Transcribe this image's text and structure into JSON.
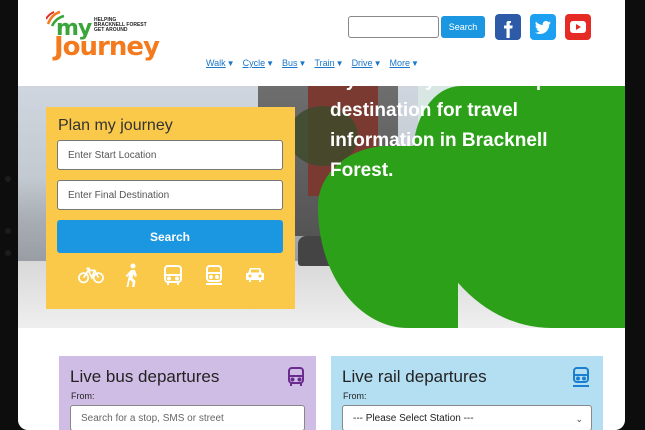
{
  "header": {
    "logo": {
      "word1": "my",
      "word2": "Journey",
      "tagline": [
        "HELPING",
        "BRACKNELL FOREST",
        "GET AROUND"
      ]
    },
    "search": {
      "value": "",
      "placeholder": "",
      "button_label": "Search"
    },
    "social": [
      {
        "name": "facebook-icon",
        "color": "#2d5ba8"
      },
      {
        "name": "twitter-icon",
        "color": "#1da0f2"
      },
      {
        "name": "youtube-icon",
        "color": "#e62a24"
      }
    ],
    "nav": [
      {
        "label": "Walk",
        "caret": "▼"
      },
      {
        "label": "Cycle",
        "caret": "▼"
      },
      {
        "label": "Bus",
        "caret": "▼"
      },
      {
        "label": "Train",
        "caret": "▼"
      },
      {
        "label": "Drive",
        "caret": "▼"
      },
      {
        "label": "More",
        "caret": "▼"
      }
    ]
  },
  "hero": {
    "headline": "My Journey - a one stop destination for travel information in Bracknell Forest."
  },
  "plan": {
    "title": "Plan my journey",
    "start_placeholder": "Enter Start Location",
    "destination_placeholder": "Enter Final Destination",
    "search_label": "Search",
    "modes": [
      "bicycle-icon",
      "walk-icon",
      "bus-icon",
      "train-icon",
      "car-icon"
    ]
  },
  "bus_departures": {
    "title": "Live bus departures",
    "from_label": "From:",
    "placeholder": "Search for a stop, SMS or street"
  },
  "rail_departures": {
    "title": "Live rail departures",
    "from_label": "From:",
    "selected": "--- Please Select Station ---"
  },
  "colors": {
    "accent_blue": "#1a97e0",
    "panel_yellow": "#fac94a",
    "hero_green": "#2ca018",
    "bus_card": "#d0bde6",
    "rail_card": "#b4dff3",
    "logo_green": "#3aa53a",
    "logo_orange": "#f47a1e"
  }
}
